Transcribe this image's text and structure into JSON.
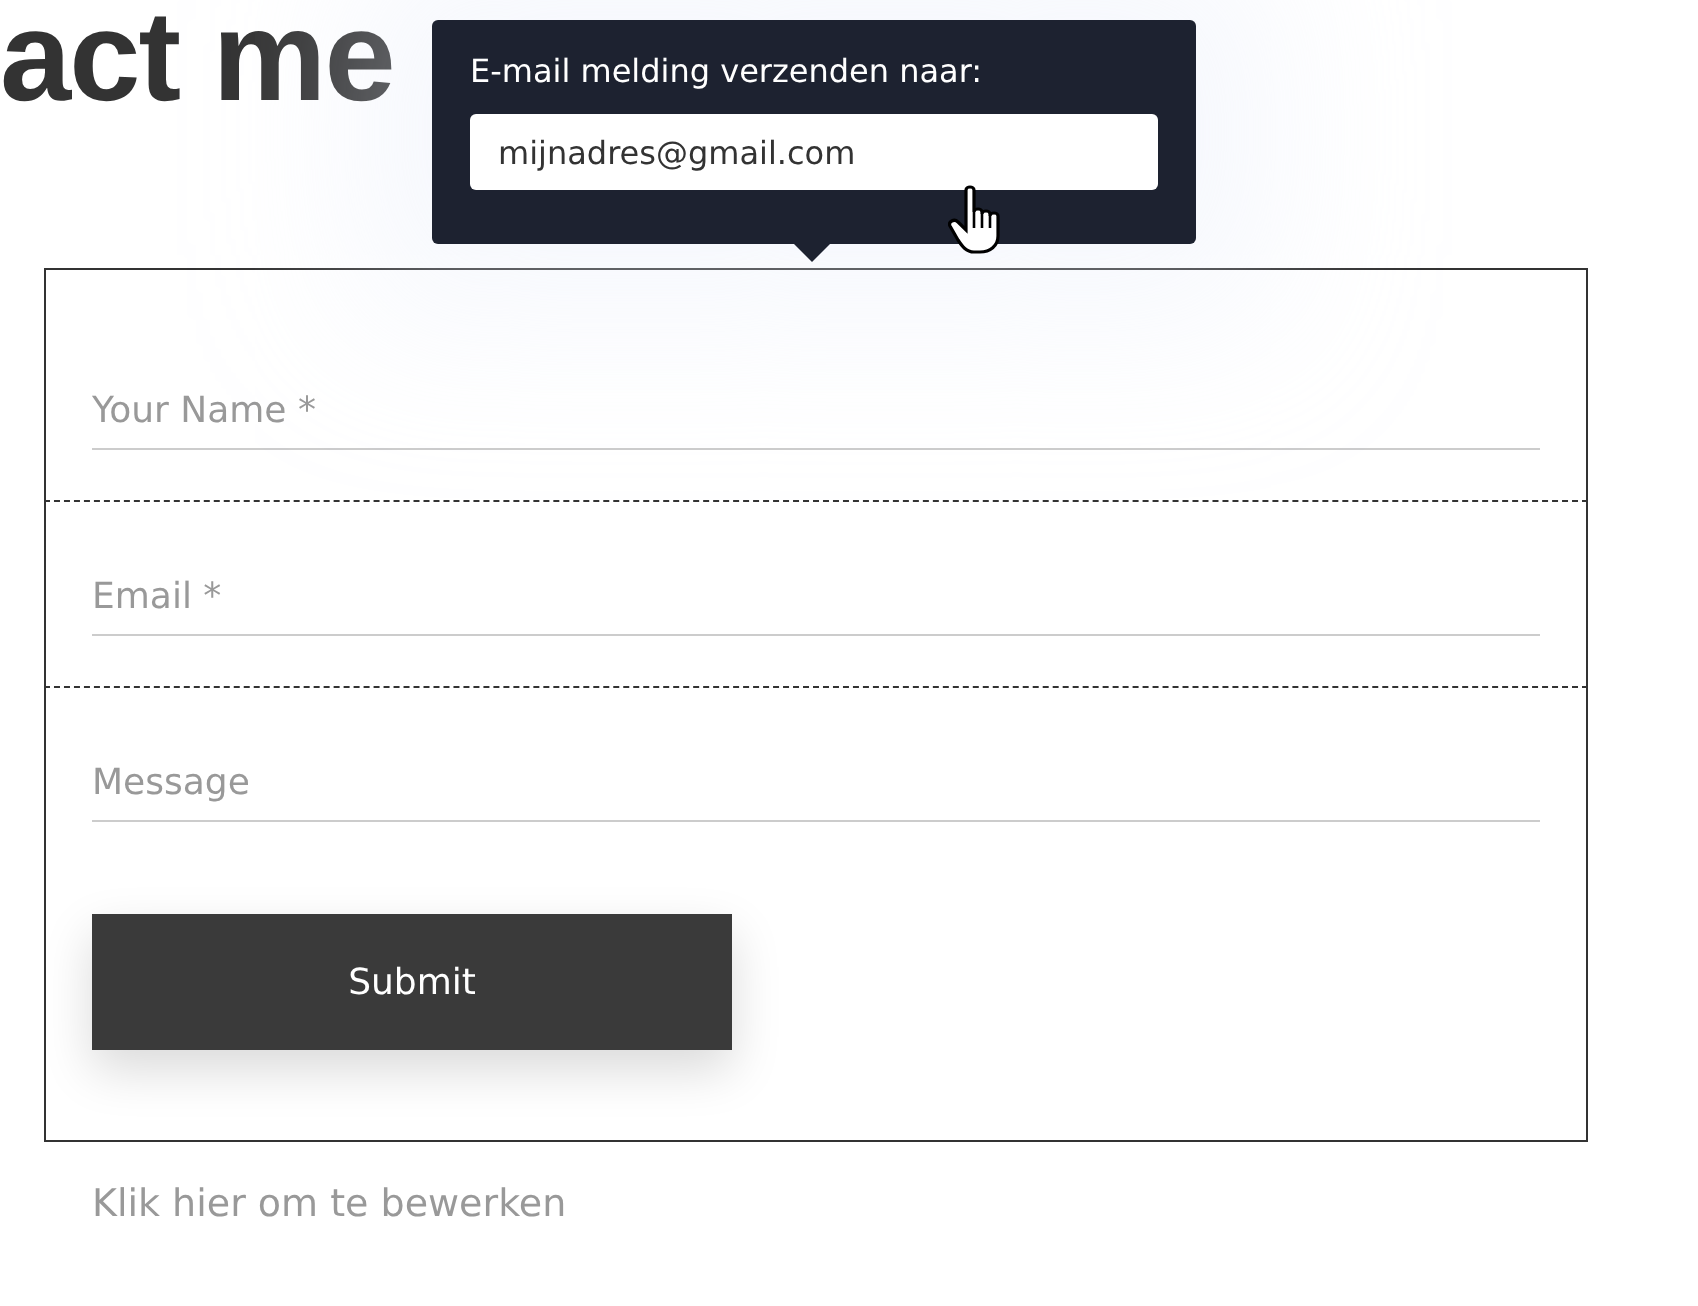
{
  "heading": "act me",
  "tooltip": {
    "label": "E-mail melding verzenden naar:",
    "value": "mijnadres@gmail.com"
  },
  "form": {
    "fields": [
      {
        "placeholder": "Your Name *",
        "selected": false
      },
      {
        "placeholder": "Email *",
        "selected": true
      },
      {
        "placeholder": "Message",
        "selected": false
      }
    ],
    "submit": "Submit"
  },
  "edit_hint": "Klik hier om te bewerken"
}
